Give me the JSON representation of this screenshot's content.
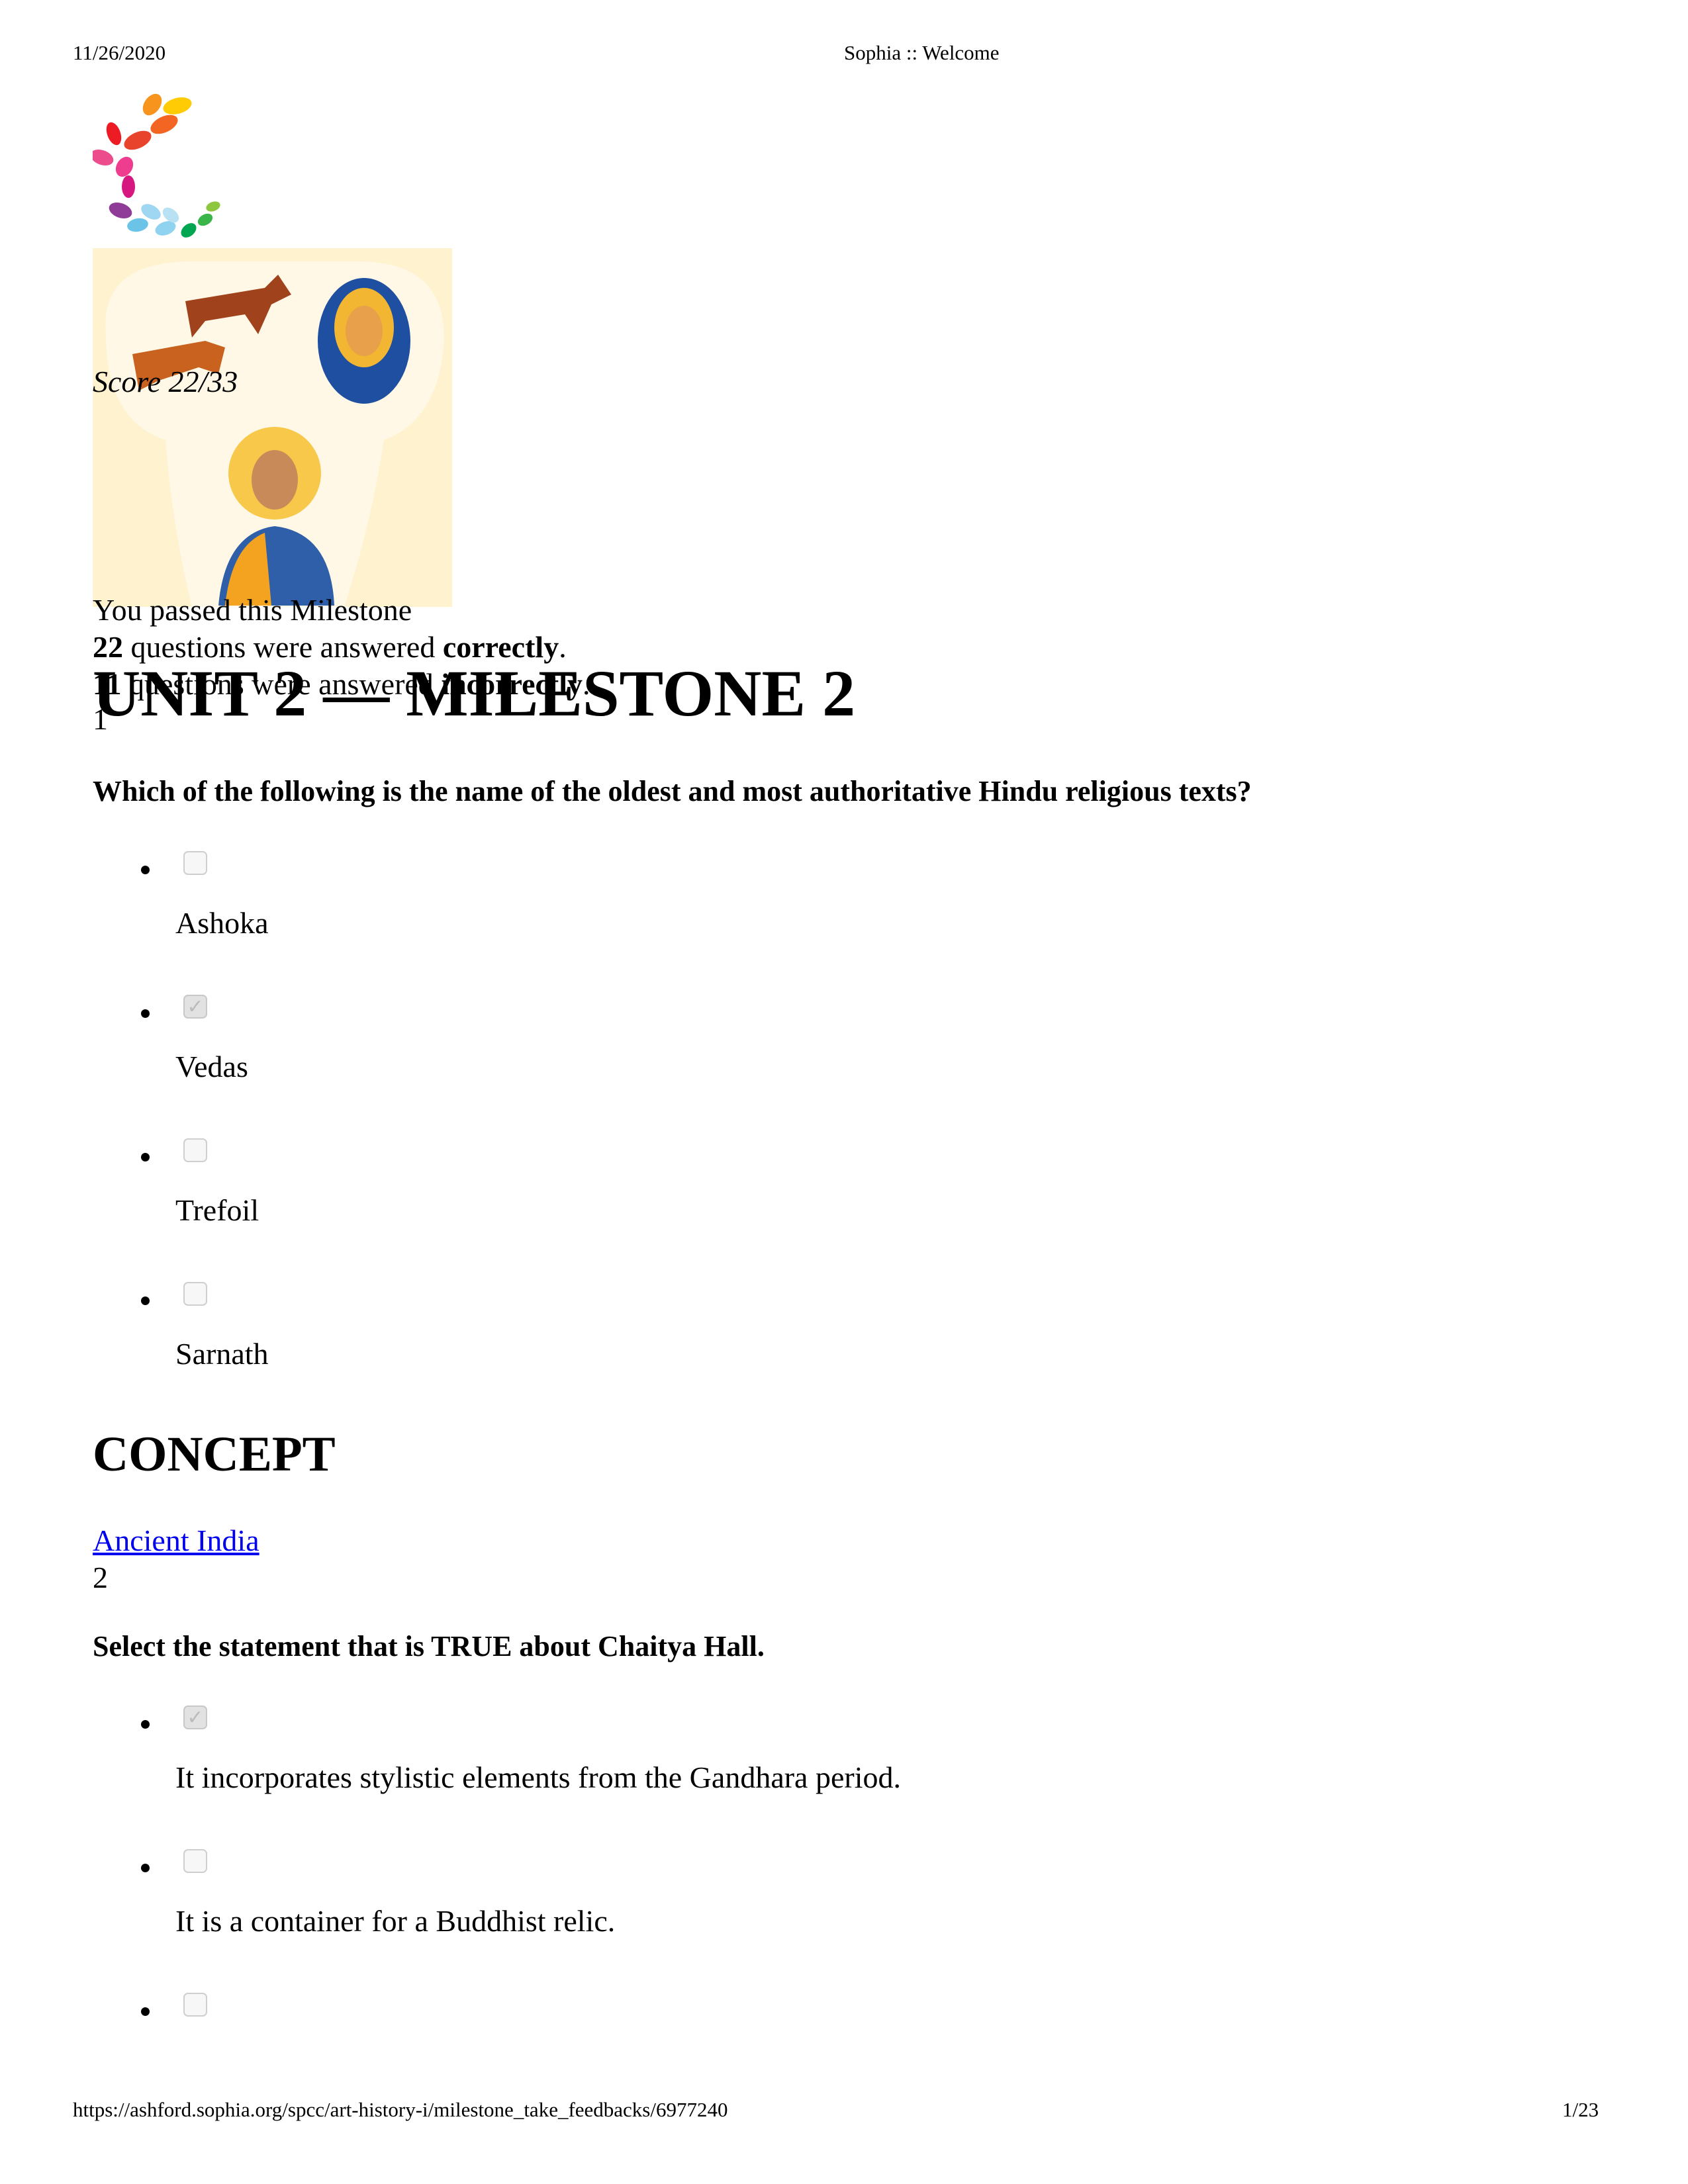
{
  "header": {
    "date": "11/26/2020",
    "title": "Sophia :: Welcome"
  },
  "score": {
    "label": "Score 22/33",
    "passed": "You passed this Milestone",
    "correct_count": "22",
    "correct_text": " questions were answered ",
    "correct_word": "correctly",
    "incorrect_count": "11",
    "incorrect_text": " questions were answered ",
    "incorrect_word": "incorrectly"
  },
  "title": "UNIT 2 — MILESTONE 2",
  "questions": [
    {
      "number": "1",
      "text": "Which of the following is the name of the oldest and most authoritative Hindu religious texts?",
      "options": [
        {
          "label": "Ashoka",
          "checked": false
        },
        {
          "label": "Vedas",
          "checked": true
        },
        {
          "label": "Trefoil",
          "checked": false
        },
        {
          "label": "Sarnath",
          "checked": false
        }
      ],
      "concept_heading": "CONCEPT",
      "concept_link": "Ancient India"
    },
    {
      "number": "2",
      "text": "Select the statement that is TRUE about Chaitya Hall.",
      "options": [
        {
          "label": "It incorporates stylistic elements from the Gandhara period.",
          "checked": true
        },
        {
          "label": "It is a container for a Buddhist relic.",
          "checked": false
        },
        {
          "label": "",
          "checked": false
        }
      ]
    }
  ],
  "footer": {
    "url": "https://ashford.sophia.org/spcc/art-history-i/milestone_take_feedbacks/6977240",
    "page": "1/23"
  }
}
